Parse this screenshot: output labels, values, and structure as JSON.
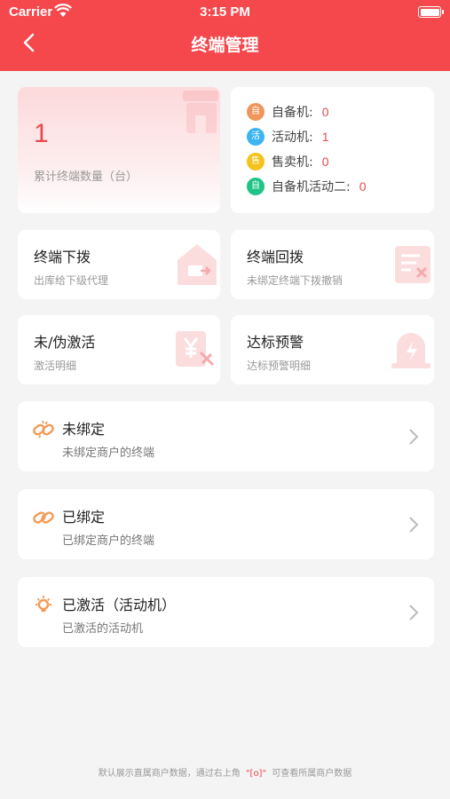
{
  "status_bar": {
    "carrier": "Carrier",
    "time": "3:15 PM"
  },
  "header": {
    "title": "终端管理"
  },
  "summary": {
    "total_value": "1",
    "total_label": "累计终端数量（台）"
  },
  "stats": [
    {
      "icon_char": "自",
      "label": "自备机:",
      "value": "0",
      "color": "#f0965c"
    },
    {
      "icon_char": "活",
      "label": "活动机:",
      "value": "1",
      "color": "#3bb4f0"
    },
    {
      "icon_char": "售",
      "label": "售卖机:",
      "value": "0",
      "color": "#f5c21b"
    },
    {
      "icon_char": "自",
      "label": "自备机活动二:",
      "value": "0",
      "color": "#1fc486"
    }
  ],
  "tiles": [
    {
      "title": "终端下拨",
      "subtitle": "出库给下级代理"
    },
    {
      "title": "终端回拨",
      "subtitle": "未绑定终端下拨撤销"
    },
    {
      "title": "未/伪激活",
      "subtitle": "激活明细"
    },
    {
      "title": "达标预警",
      "subtitle": "达标预警明细"
    }
  ],
  "rows": [
    {
      "title": "未绑定",
      "subtitle": "未绑定商户的终端"
    },
    {
      "title": "已绑定",
      "subtitle": "已绑定商户的终端"
    },
    {
      "title": "已激活（活动机）",
      "subtitle": "已激活的活动机"
    }
  ],
  "footer": {
    "text_before": "默认展示直属商户数据，通过右上角",
    "scan_symbol": "\"[o]\"",
    "text_after": "可查看所属商户数据"
  },
  "colors": {
    "brand": "#f4484d",
    "accent_red": "#e74a4f",
    "icon_orange": "#f39a55"
  }
}
